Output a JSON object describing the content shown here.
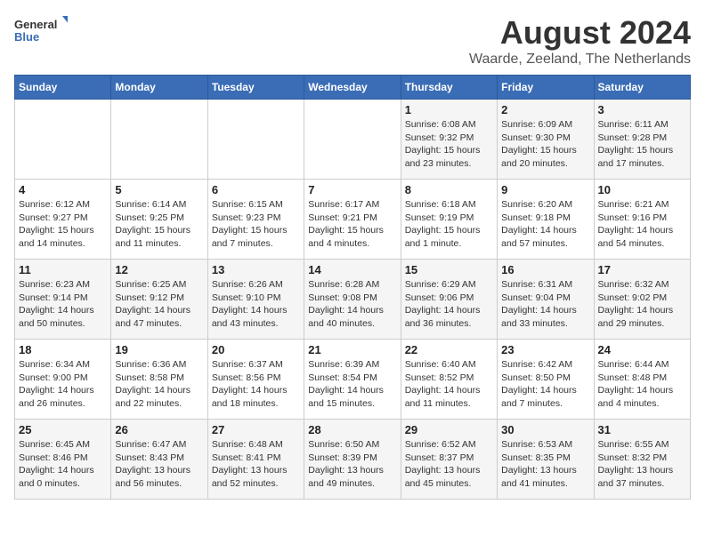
{
  "header": {
    "logo_general": "General",
    "logo_blue": "Blue",
    "month_title": "August 2024",
    "location": "Waarde, Zeeland, The Netherlands"
  },
  "weekdays": [
    "Sunday",
    "Monday",
    "Tuesday",
    "Wednesday",
    "Thursday",
    "Friday",
    "Saturday"
  ],
  "weeks": [
    [
      {
        "day": "",
        "info": ""
      },
      {
        "day": "",
        "info": ""
      },
      {
        "day": "",
        "info": ""
      },
      {
        "day": "",
        "info": ""
      },
      {
        "day": "1",
        "info": "Sunrise: 6:08 AM\nSunset: 9:32 PM\nDaylight: 15 hours\nand 23 minutes."
      },
      {
        "day": "2",
        "info": "Sunrise: 6:09 AM\nSunset: 9:30 PM\nDaylight: 15 hours\nand 20 minutes."
      },
      {
        "day": "3",
        "info": "Sunrise: 6:11 AM\nSunset: 9:28 PM\nDaylight: 15 hours\nand 17 minutes."
      }
    ],
    [
      {
        "day": "4",
        "info": "Sunrise: 6:12 AM\nSunset: 9:27 PM\nDaylight: 15 hours\nand 14 minutes."
      },
      {
        "day": "5",
        "info": "Sunrise: 6:14 AM\nSunset: 9:25 PM\nDaylight: 15 hours\nand 11 minutes."
      },
      {
        "day": "6",
        "info": "Sunrise: 6:15 AM\nSunset: 9:23 PM\nDaylight: 15 hours\nand 7 minutes."
      },
      {
        "day": "7",
        "info": "Sunrise: 6:17 AM\nSunset: 9:21 PM\nDaylight: 15 hours\nand 4 minutes."
      },
      {
        "day": "8",
        "info": "Sunrise: 6:18 AM\nSunset: 9:19 PM\nDaylight: 15 hours\nand 1 minute."
      },
      {
        "day": "9",
        "info": "Sunrise: 6:20 AM\nSunset: 9:18 PM\nDaylight: 14 hours\nand 57 minutes."
      },
      {
        "day": "10",
        "info": "Sunrise: 6:21 AM\nSunset: 9:16 PM\nDaylight: 14 hours\nand 54 minutes."
      }
    ],
    [
      {
        "day": "11",
        "info": "Sunrise: 6:23 AM\nSunset: 9:14 PM\nDaylight: 14 hours\nand 50 minutes."
      },
      {
        "day": "12",
        "info": "Sunrise: 6:25 AM\nSunset: 9:12 PM\nDaylight: 14 hours\nand 47 minutes."
      },
      {
        "day": "13",
        "info": "Sunrise: 6:26 AM\nSunset: 9:10 PM\nDaylight: 14 hours\nand 43 minutes."
      },
      {
        "day": "14",
        "info": "Sunrise: 6:28 AM\nSunset: 9:08 PM\nDaylight: 14 hours\nand 40 minutes."
      },
      {
        "day": "15",
        "info": "Sunrise: 6:29 AM\nSunset: 9:06 PM\nDaylight: 14 hours\nand 36 minutes."
      },
      {
        "day": "16",
        "info": "Sunrise: 6:31 AM\nSunset: 9:04 PM\nDaylight: 14 hours\nand 33 minutes."
      },
      {
        "day": "17",
        "info": "Sunrise: 6:32 AM\nSunset: 9:02 PM\nDaylight: 14 hours\nand 29 minutes."
      }
    ],
    [
      {
        "day": "18",
        "info": "Sunrise: 6:34 AM\nSunset: 9:00 PM\nDaylight: 14 hours\nand 26 minutes."
      },
      {
        "day": "19",
        "info": "Sunrise: 6:36 AM\nSunset: 8:58 PM\nDaylight: 14 hours\nand 22 minutes."
      },
      {
        "day": "20",
        "info": "Sunrise: 6:37 AM\nSunset: 8:56 PM\nDaylight: 14 hours\nand 18 minutes."
      },
      {
        "day": "21",
        "info": "Sunrise: 6:39 AM\nSunset: 8:54 PM\nDaylight: 14 hours\nand 15 minutes."
      },
      {
        "day": "22",
        "info": "Sunrise: 6:40 AM\nSunset: 8:52 PM\nDaylight: 14 hours\nand 11 minutes."
      },
      {
        "day": "23",
        "info": "Sunrise: 6:42 AM\nSunset: 8:50 PM\nDaylight: 14 hours\nand 7 minutes."
      },
      {
        "day": "24",
        "info": "Sunrise: 6:44 AM\nSunset: 8:48 PM\nDaylight: 14 hours\nand 4 minutes."
      }
    ],
    [
      {
        "day": "25",
        "info": "Sunrise: 6:45 AM\nSunset: 8:46 PM\nDaylight: 14 hours\nand 0 minutes."
      },
      {
        "day": "26",
        "info": "Sunrise: 6:47 AM\nSunset: 8:43 PM\nDaylight: 13 hours\nand 56 minutes."
      },
      {
        "day": "27",
        "info": "Sunrise: 6:48 AM\nSunset: 8:41 PM\nDaylight: 13 hours\nand 52 minutes."
      },
      {
        "day": "28",
        "info": "Sunrise: 6:50 AM\nSunset: 8:39 PM\nDaylight: 13 hours\nand 49 minutes."
      },
      {
        "day": "29",
        "info": "Sunrise: 6:52 AM\nSunset: 8:37 PM\nDaylight: 13 hours\nand 45 minutes."
      },
      {
        "day": "30",
        "info": "Sunrise: 6:53 AM\nSunset: 8:35 PM\nDaylight: 13 hours\nand 41 minutes."
      },
      {
        "day": "31",
        "info": "Sunrise: 6:55 AM\nSunset: 8:32 PM\nDaylight: 13 hours\nand 37 minutes."
      }
    ]
  ]
}
